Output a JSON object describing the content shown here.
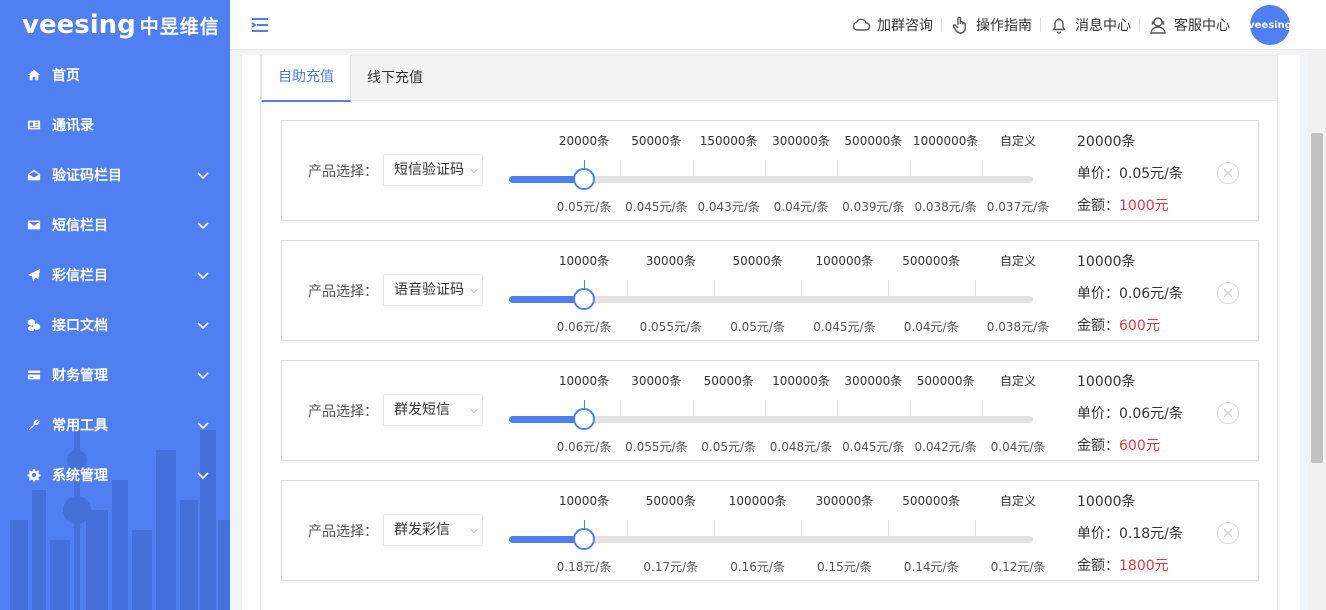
{
  "brand": {
    "name_en": "veesing",
    "name_cn": "中昱维信",
    "avatar_text": "veesing"
  },
  "sidebar": {
    "items": [
      {
        "label": "首页",
        "icon": "home-icon",
        "has_submenu": false
      },
      {
        "label": "通讯录",
        "icon": "contact-card-icon",
        "has_submenu": false
      },
      {
        "label": "验证码栏目",
        "icon": "envelope-open-icon",
        "has_submenu": true
      },
      {
        "label": "短信栏目",
        "icon": "envelope-icon",
        "has_submenu": true
      },
      {
        "label": "彩信栏目",
        "icon": "send-icon",
        "has_submenu": true
      },
      {
        "label": "接口文档",
        "icon": "cubes-icon",
        "has_submenu": true
      },
      {
        "label": "财务管理",
        "icon": "credit-card-icon",
        "has_submenu": true
      },
      {
        "label": "常用工具",
        "icon": "wrench-icon",
        "has_submenu": true
      },
      {
        "label": "系统管理",
        "icon": "gear-icon",
        "has_submenu": true
      }
    ]
  },
  "header": {
    "nav": [
      {
        "label": "加群咨询",
        "icon": "cloud-icon"
      },
      {
        "label": "操作指南",
        "icon": "hand-pointer-icon"
      },
      {
        "label": "消息中心",
        "icon": "bell-icon"
      },
      {
        "label": "客服中心",
        "icon": "support-agent-icon"
      }
    ]
  },
  "tabs": [
    {
      "label": "自助充值",
      "active": true
    },
    {
      "label": "线下充值",
      "active": false
    }
  ],
  "cards": [
    {
      "product_label": "产品选择：",
      "product": "短信验证码",
      "quantities": [
        "20000条",
        "50000条",
        "150000条",
        "300000条",
        "500000条",
        "1000000条",
        "自定义"
      ],
      "prices": [
        "0.05元/条",
        "0.045元/条",
        "0.043元/条",
        "0.04元/条",
        "0.039元/条",
        "0.038元/条",
        "0.037元/条"
      ],
      "selected_index": 0,
      "selected_qty": "20000条",
      "unit_price": "单价：0.05元/条",
      "amount_label": "金额：",
      "amount": "1000元"
    },
    {
      "product_label": "产品选择：",
      "product": "语音验证码",
      "quantities": [
        "10000条",
        "30000条",
        "50000条",
        "100000条",
        "500000条",
        "自定义"
      ],
      "prices": [
        "0.06元/条",
        "0.055元/条",
        "0.05元/条",
        "0.045元/条",
        "0.04元/条",
        "0.038元/条"
      ],
      "selected_index": 0,
      "selected_qty": "10000条",
      "unit_price": "单价：0.06元/条",
      "amount_label": "金额：",
      "amount": "600元"
    },
    {
      "product_label": "产品选择：",
      "product": "群发短信",
      "quantities": [
        "10000条",
        "30000条",
        "50000条",
        "100000条",
        "300000条",
        "500000条",
        "自定义"
      ],
      "prices": [
        "0.06元/条",
        "0.055元/条",
        "0.05元/条",
        "0.048元/条",
        "0.045元/条",
        "0.042元/条",
        "0.04元/条"
      ],
      "selected_index": 0,
      "selected_qty": "10000条",
      "unit_price": "单价：0.06元/条",
      "amount_label": "金额：",
      "amount": "600元"
    },
    {
      "product_label": "产品选择：",
      "product": "群发彩信",
      "quantities": [
        "10000条",
        "50000条",
        "100000条",
        "300000条",
        "500000条",
        "自定义"
      ],
      "prices": [
        "0.18元/条",
        "0.17元/条",
        "0.16元/条",
        "0.15元/条",
        "0.14元/条",
        "0.12元/条"
      ],
      "selected_index": 0,
      "selected_qty": "10000条",
      "unit_price": "单价：0.18元/条",
      "amount_label": "金额：",
      "amount": "1800元"
    }
  ],
  "colors": {
    "primary": "#4f7ff0",
    "amount_red": "#e4393c",
    "sidebar_bg": "#4f7ff0"
  }
}
